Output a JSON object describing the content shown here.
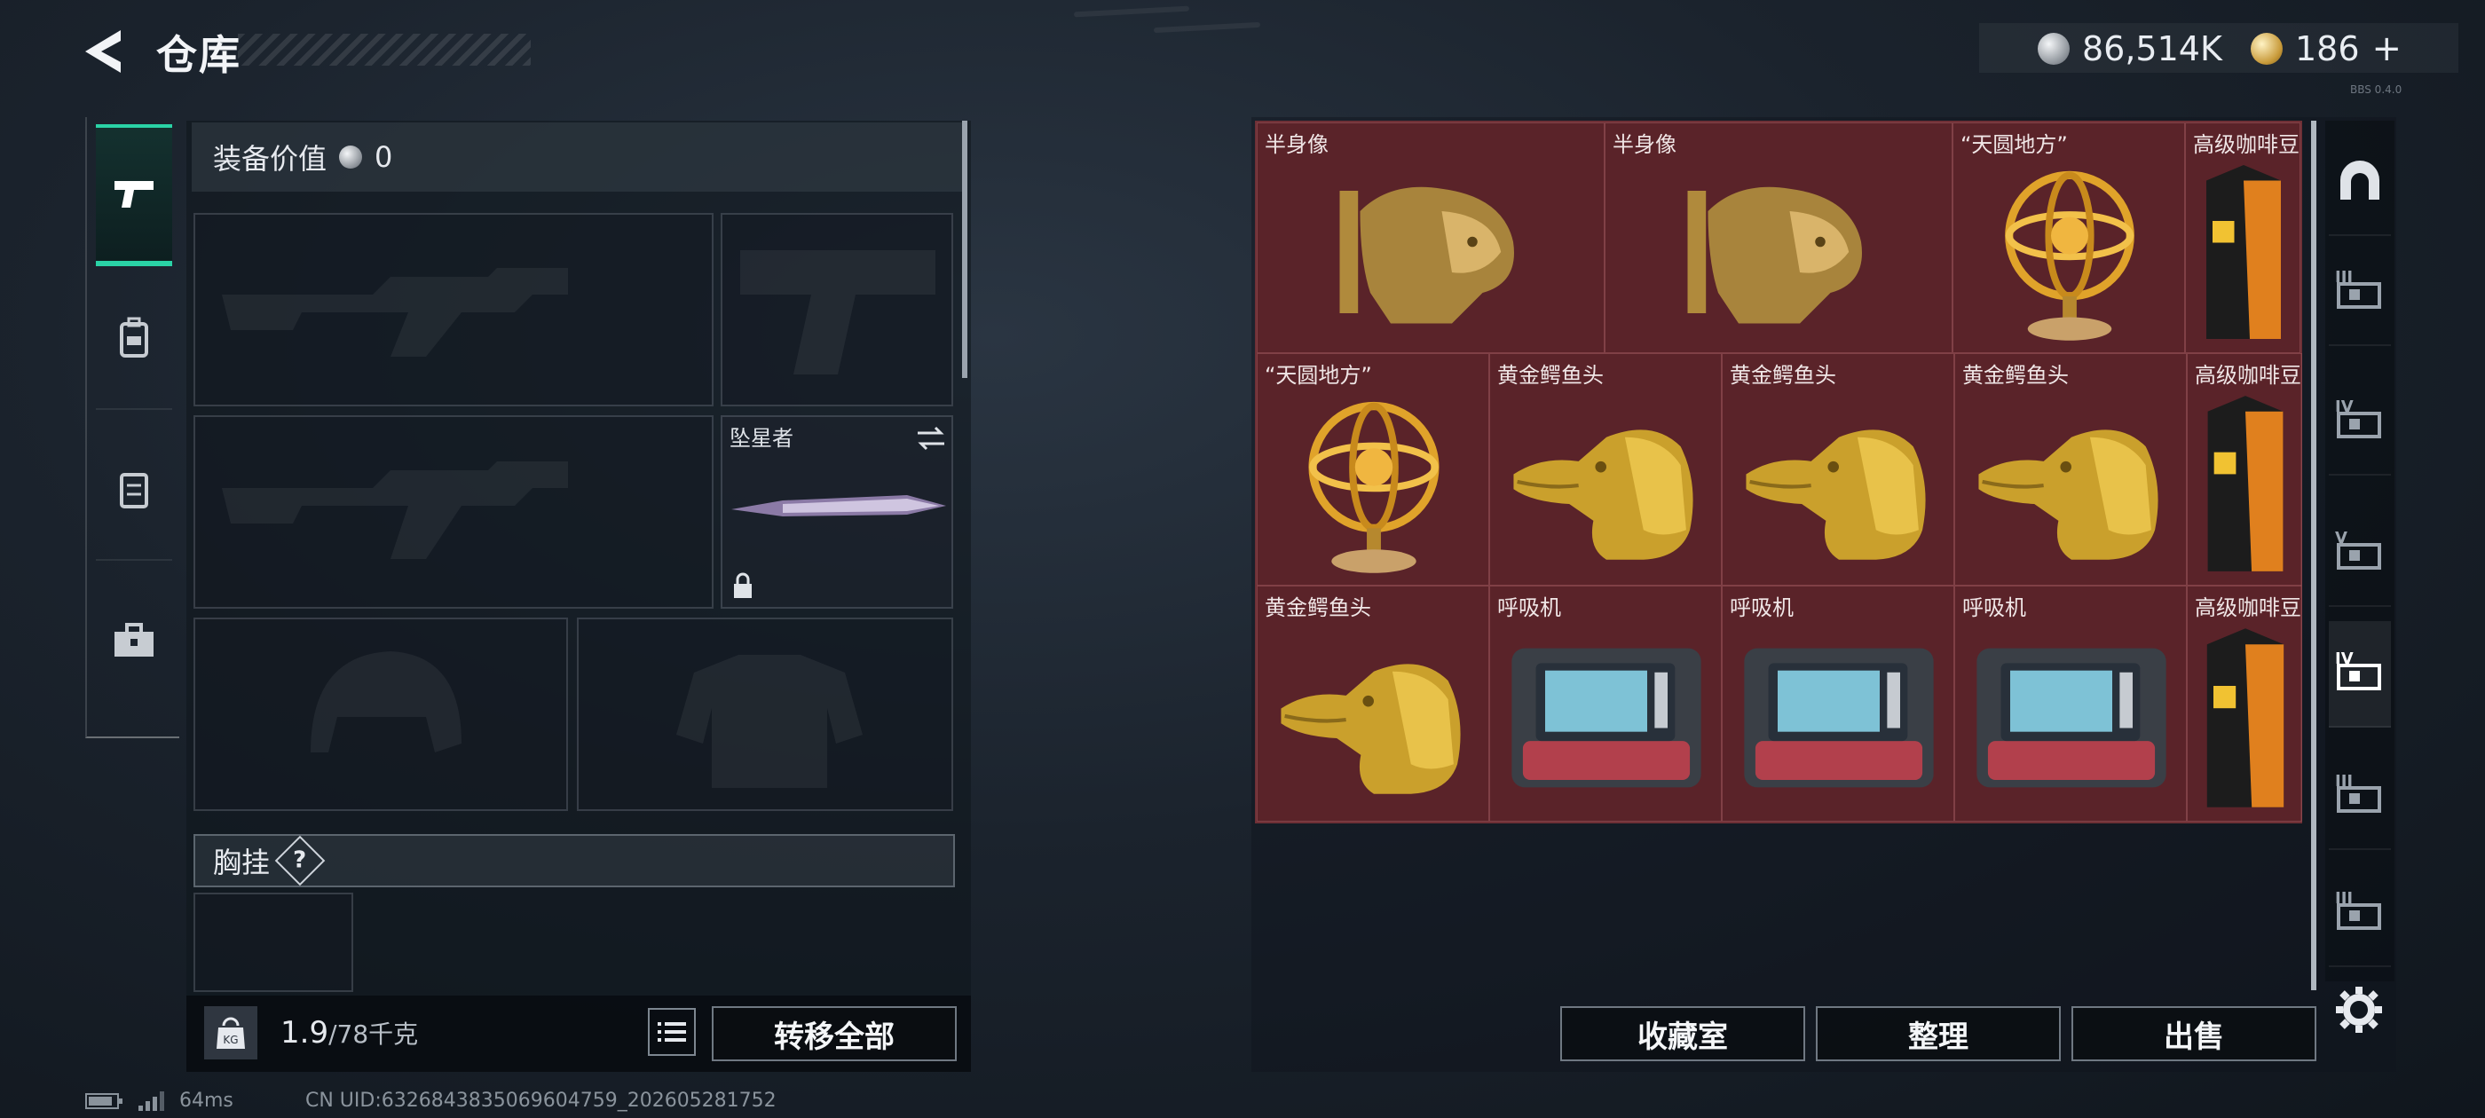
{
  "header": {
    "title": "仓库",
    "silver_amount": "86,514K",
    "gold_amount": "186",
    "gold_plus": "+",
    "version": "BBS 0.4.0"
  },
  "left_rail": {
    "items": [
      {
        "icon": "pistol-icon",
        "active": true
      },
      {
        "icon": "backpack-icon",
        "active": false
      },
      {
        "icon": "vest-icon",
        "active": false
      },
      {
        "icon": "toolbox-icon",
        "active": false
      }
    ]
  },
  "equipment": {
    "value_label": "装备价值",
    "value": "0",
    "melee_name": "坠星者",
    "chest_rig_label": "胸挂",
    "help_symbol": "?"
  },
  "weight": {
    "current": "1.9",
    "max": "/78千克",
    "transfer_all_label": "转移全部"
  },
  "storage": {
    "items": [
      {
        "label": "半身像",
        "icon": "bust-icon"
      },
      {
        "label": "半身像",
        "icon": "bust-icon"
      },
      {
        "label": "“天圆地方”",
        "icon": "armillary-sphere-icon"
      },
      {
        "label": "高级咖啡豆",
        "icon": "coffee-bag-icon"
      },
      {
        "label": "“天圆地方”",
        "icon": "armillary-sphere-icon"
      },
      {
        "label": "黄金鳄鱼头",
        "icon": "golden-crocodile-icon"
      },
      {
        "label": "黄金鳄鱼头",
        "icon": "golden-crocodile-icon"
      },
      {
        "label": "黄金鳄鱼头",
        "icon": "golden-crocodile-icon"
      },
      {
        "label": "高级咖啡豆",
        "icon": "coffee-bag-icon"
      },
      {
        "label": "黄金鳄鱼头",
        "icon": "golden-crocodile-icon"
      },
      {
        "label": "呼吸机",
        "icon": "ventilator-icon"
      },
      {
        "label": "呼吸机",
        "icon": "ventilator-icon"
      },
      {
        "label": "呼吸机",
        "icon": "ventilator-icon"
      },
      {
        "label": "高级咖啡豆",
        "icon": "coffee-bag-icon"
      }
    ],
    "side_tabs": [
      "I",
      "III",
      "IV",
      "V",
      "IV",
      "III",
      "III"
    ],
    "buttons": {
      "collection": "收藏室",
      "organize": "整理",
      "sell": "出售"
    }
  },
  "status": {
    "ping": "64ms",
    "uid": "CN UID:6326843835069604759_202605281752"
  },
  "colors": {
    "accent": "#2ad3a6",
    "grid_bg": "#5a2329",
    "gold": "#c89a3a"
  }
}
